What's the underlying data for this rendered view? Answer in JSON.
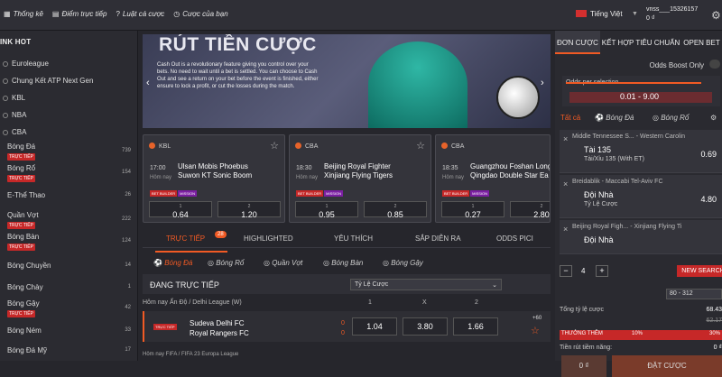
{
  "top_nav": {
    "items": [
      "Thống kê",
      "Điểm trực tiếp",
      "Luật cá cược",
      "Cược của bạn"
    ],
    "language": "Tiếng Việt",
    "username": "vnss___15326157",
    "balance": "0 ₫"
  },
  "left_sidebar": {
    "header": "INK HOT",
    "hot_items": [
      "Euroleague",
      "Chung Kết ATP Next Gen",
      "KBL",
      "NBA",
      "CBA"
    ],
    "sports": [
      {
        "name": "Bóng Đá",
        "live": true,
        "count": "739"
      },
      {
        "name": "Bóng Rổ",
        "live": true,
        "count": "154"
      },
      {
        "name": "E-Thể Thao",
        "live": false,
        "count": "26"
      },
      {
        "name": "Quần Vợt",
        "live": true,
        "count": "222"
      },
      {
        "name": "Bóng Bàn",
        "live": true,
        "count": "124"
      },
      {
        "name": "Bóng Chuyền",
        "live": false,
        "count": "14"
      },
      {
        "name": "Bóng Chày",
        "live": false,
        "count": "1"
      },
      {
        "name": "Bóng Gậy",
        "live": true,
        "count": "42"
      },
      {
        "name": "Bóng Ném",
        "live": false,
        "count": "33"
      },
      {
        "name": "Bóng Đá Mỹ",
        "live": false,
        "count": "17"
      }
    ],
    "live_label": "TRỰC TIẾP"
  },
  "banner": {
    "title": "RÚT TIỀN CƯỢC",
    "text": "Cash Out is a revolutionary feature giving you control over your bets. No need to wait until a bet is settled. You can choose to Cash Out and see a return on your bet before the event is finished, either ensure to lock a profit, or cut the losses during the match."
  },
  "cards": [
    {
      "league": "KBL",
      "time": "17:00",
      "day": "Hôm nay",
      "team1": "Ulsan Mobis Phoebus",
      "team2": "Suwon KT Sonic Boom",
      "tag1": "BET BUILDER",
      "tag2": "MISSION",
      "o1": "0.64",
      "o2": "1.20",
      "l1": "1",
      "l2": "2"
    },
    {
      "league": "CBA",
      "time": "18:30",
      "day": "Hôm nay",
      "team1": "Beijing Royal Fighter",
      "team2": "Xinjiang Flying Tigers",
      "tag1": "BET BUILDER",
      "tag2": "MISSION",
      "o1": "0.95",
      "o2": "0.85",
      "l1": "1",
      "l2": "2"
    },
    {
      "league": "CBA",
      "time": "18:35",
      "day": "Hôm nay",
      "team1": "Guangzhou Foshan Longli",
      "team2": "Qingdao Double Star Ea",
      "tag1": "BET BUILDER",
      "tag2": "MISSION",
      "o1": "0.27",
      "o2": "2.80",
      "l1": "1",
      "l2": "2"
    }
  ],
  "main_tabs": {
    "items": [
      "TRỰC TIẾP",
      "HIGHLIGHTED",
      "YÊU THÍCH",
      "SẮP DIỄN RA",
      "ODDS PICI"
    ],
    "badge": "28"
  },
  "sport_tabs": [
    "Bóng Đá",
    "Bóng Rổ",
    "Quần Vợt",
    "Bóng Bàn",
    "Bóng Gậy"
  ],
  "live_section": {
    "title": "ĐANG TRỰC TIẾP",
    "select": "Tỷ Lệ Cược",
    "cols": [
      "1",
      "X",
      "2"
    ]
  },
  "league_line": "Hôm nay  Ấn Độ / Delhi League (W)",
  "match": {
    "live": "TRỰC TIẾP",
    "team1": "Sudeva Delhi FC",
    "team2": "Royal Rangers FC",
    "s1": "0",
    "s2": "0",
    "o1": "1.04",
    "ox": "3.80",
    "o2": "1.66",
    "more": "+60"
  },
  "next_league": "Hôm nay  FIFA / FIFA 23 Europa League",
  "right_panel": {
    "tabs": [
      "ĐƠN CƯỢC",
      "KẾT HỢP TIÊU CHUẨN",
      "OPEN BET"
    ],
    "boost": "Odds Boost Only",
    "odds_label": "Odds per selection",
    "odds_range": "0.01 - 9.00",
    "filter_tabs": [
      "Tất cả",
      "Bóng Đá",
      "Bóng Rổ"
    ],
    "bets": [
      {
        "match": "Middle Tennessee S... - Western Carolin",
        "sel": "Tài 135",
        "desc": "Tài/Xỉu 135 (With ET)",
        "odds": "0.69"
      },
      {
        "match": "Breidablik - Maccabi Tel-Aviv FC",
        "sel": "Đội Nhà",
        "desc": "Tỷ Lệ Cược",
        "odds": "4.80"
      },
      {
        "match": "Beijing Royal Figh... - Xinjiang Flying Ti",
        "sel": "Đội Nhà",
        "desc": "",
        "odds": ""
      }
    ],
    "stake_count": "4",
    "new_search": "NEW SEARCH",
    "range": "80 - 312",
    "total_label": "Tổng tỷ lệ cược",
    "total": "68.43",
    "total_old": "62.17",
    "bonus_label": "THƯỞNG THÊM",
    "bonus_pct": "10%",
    "bonus_right": "30%",
    "win_label": "Tiền rút tiềm năng:",
    "win": "0 ₫",
    "zero": "0 ₫",
    "place": "ĐẶT CƯỢC"
  }
}
